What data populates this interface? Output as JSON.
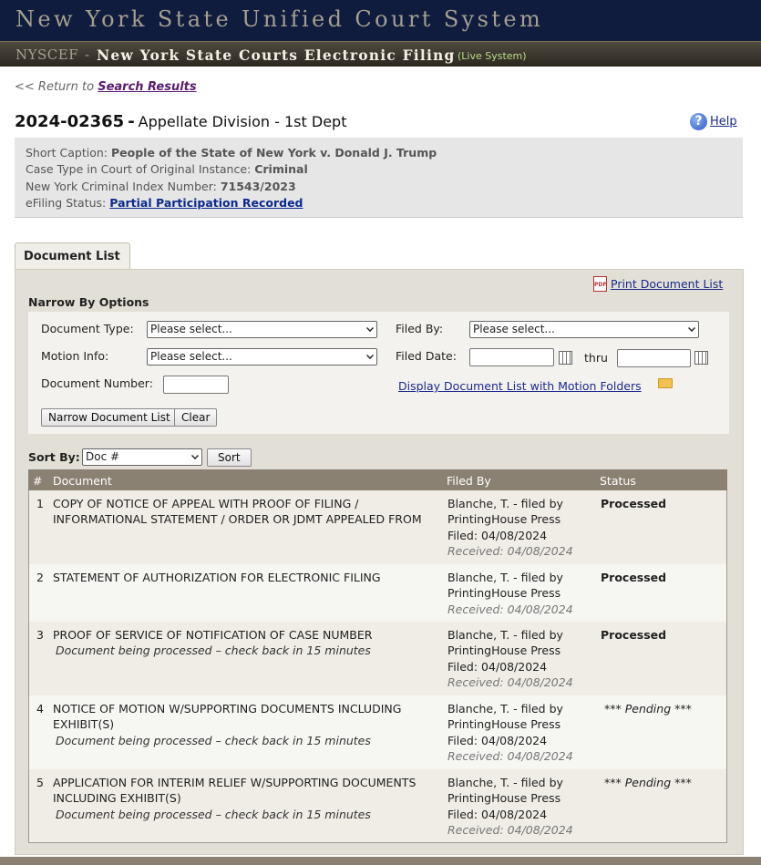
{
  "header": {
    "title": "New York State Unified Court System",
    "nyscef": "NYSCEF",
    "name": "New York State Courts Electronic Filing",
    "live": "(Live System)"
  },
  "nav": {
    "return_prefix": "<< Return to",
    "return_link": "Search Results"
  },
  "case": {
    "number": "2024-02365",
    "court": "Appellate Division - 1st Dept",
    "help": "Help"
  },
  "summary": {
    "caption_label": "Short Caption:",
    "caption_value": "People of the State of New York v. Donald J. Trump",
    "casetype_label": "Case Type in Court of Original Instance:",
    "casetype_value": "Criminal",
    "index_label": "New York Criminal Index Number:",
    "index_value": "71543/2023",
    "status_label": "eFiling Status:",
    "status_value": "Partial Participation Recorded"
  },
  "tabs": {
    "document_list": "Document List"
  },
  "toolbar": {
    "print": "Print Document List",
    "pdf_icon_text": "PDF"
  },
  "filters": {
    "narrow_title": "Narrow By Options",
    "doc_type_label": "Document Type:",
    "doc_type_value": "Please select...",
    "motion_label": "Motion Info:",
    "motion_value": "Please select...",
    "doc_num_label": "Document Number:",
    "filed_by_label": "Filed By:",
    "filed_by_value": "Please select...",
    "filed_date_label": "Filed Date:",
    "thru": "thru",
    "motion_folders_link": "Display Document List with Motion Folders",
    "narrow_button": "Narrow Document List",
    "clear_button": "Clear"
  },
  "sort": {
    "label": "Sort By:",
    "value": "Doc #",
    "button": "Sort"
  },
  "table": {
    "headers": {
      "num": "#",
      "document": "Document",
      "filed_by": "Filed By",
      "status": "Status"
    },
    "rows": [
      {
        "num": "1",
        "doc1": "COPY OF NOTICE OF APPEAL WITH PROOF OF FILING /",
        "doc2": "INFORMATIONAL STATEMENT / ORDER OR JDMT APPEALED FROM",
        "note": "",
        "filer1": "Blanche, T. - filed by",
        "filer2": "PrintingHouse Press",
        "filed": "Filed: 04/08/2024",
        "received": "Received: 04/08/2024",
        "status": "Processed"
      },
      {
        "num": "2",
        "doc1": "STATEMENT OF AUTHORIZATION FOR ELECTRONIC FILING",
        "doc2": "",
        "note": "",
        "filer1": "Blanche, T. - filed by",
        "filer2": "PrintingHouse Press",
        "filed": "",
        "received": "Received: 04/08/2024",
        "status": "Processed"
      },
      {
        "num": "3",
        "doc1": "PROOF OF SERVICE OF NOTIFICATION OF CASE NUMBER",
        "doc2": "",
        "note": "Document being processed – check back in 15 minutes",
        "filer1": "Blanche, T. - filed by",
        "filer2": "PrintingHouse Press",
        "filed": "Filed: 04/08/2024",
        "received": "Received: 04/08/2024",
        "status": "Processed"
      },
      {
        "num": "4",
        "doc1": "NOTICE OF MOTION W/SUPPORTING DOCUMENTS INCLUDING",
        "doc2": "EXHIBIT(S)",
        "note": "Document being processed – check back in 15 minutes",
        "filer1": "Blanche, T. - filed by",
        "filer2": "PrintingHouse Press",
        "filed": "Filed: 04/08/2024",
        "received": "Received: 04/08/2024",
        "status": "*** Pending ***"
      },
      {
        "num": "5",
        "doc1": "APPLICATION FOR INTERIM RELIEF W/SUPPORTING DOCUMENTS",
        "doc2": "INCLUDING EXHIBIT(S)",
        "note": "Document being processed – check back in 15 minutes",
        "filer1": "Blanche, T. - filed by",
        "filer2": "PrintingHouse Press",
        "filed": "Filed: 04/08/2024",
        "received": "Received: 04/08/2024",
        "status": "*** Pending ***"
      }
    ]
  },
  "colors": {
    "banner": "#0f1c3e",
    "header_row": "#8b8172",
    "processed": "#1c7a1c",
    "link": "#1a2a8c"
  }
}
